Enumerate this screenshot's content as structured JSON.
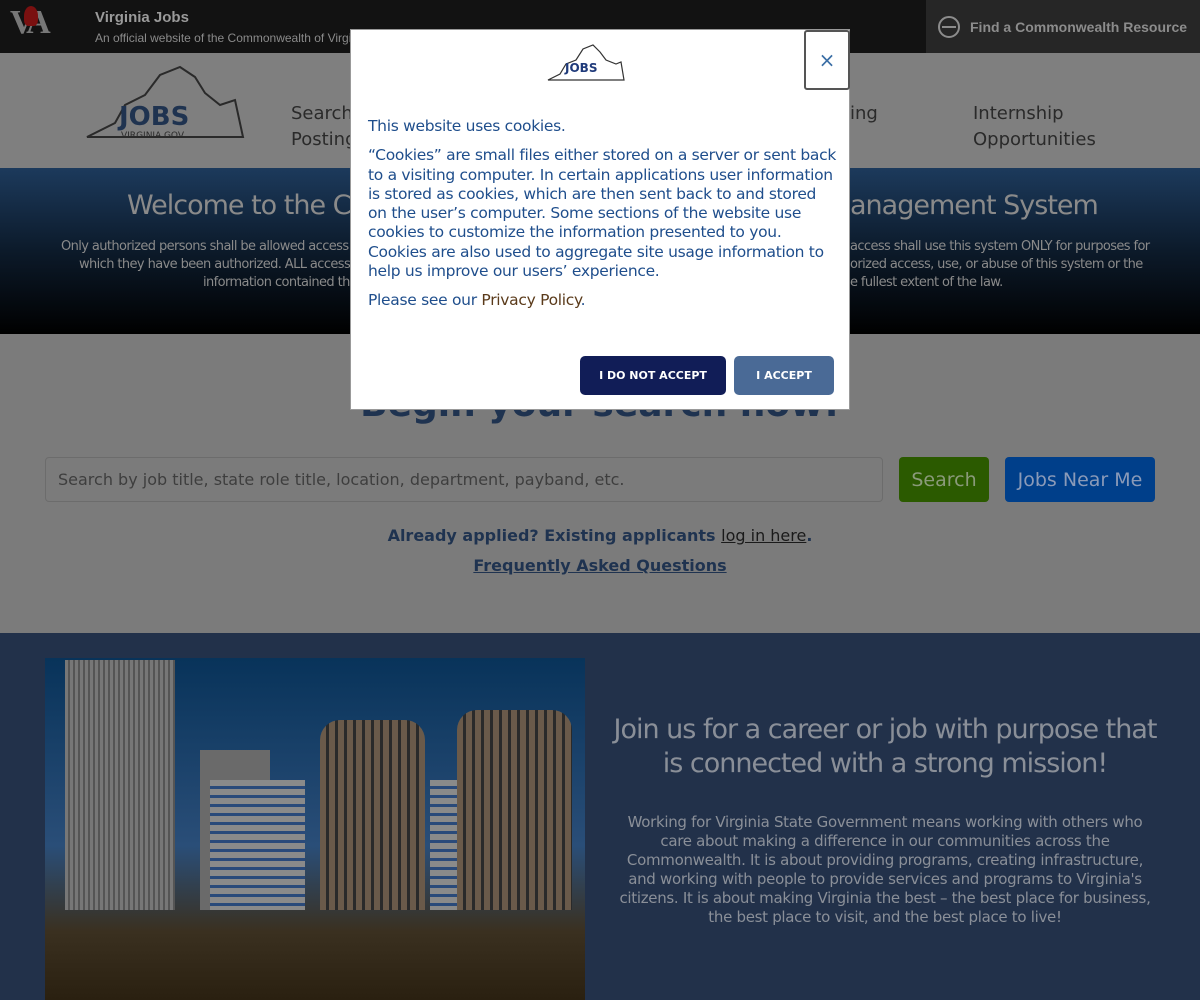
{
  "topbar": {
    "logo_text": "VA",
    "title": "Virginia Jobs",
    "subtitle": "An official website of the Commonwealth of Virgi",
    "resource_link": "Find a Commonwealth Resource"
  },
  "nav": {
    "logo_text": "JOBS",
    "logo_sub": "VIRGINIA.GOV",
    "items": [
      {
        "line1": "Search",
        "line2": "Posting"
      },
      {
        "line1": "ing",
        "line2": ""
      },
      {
        "line1": "Internship",
        "line2": "Opportunities"
      }
    ]
  },
  "banner": {
    "welcome_left": "Welcome to the Co",
    "welcome_right": "anagement System",
    "auth_left": [
      "Only authorized persons shall be allowed access to",
      "which they have been authorized. ALL access ar",
      "information contained the"
    ],
    "auth_right": [
      "access shall use this system ONLY for purposes for",
      "orized access, use, or abuse of this system or the",
      "e fullest extent of the law."
    ]
  },
  "search": {
    "heading": "Begin your search now!",
    "placeholder": "Search by job title, state role title, location, department, payband, etc.",
    "search_button": "Search",
    "near_button": "Jobs Near Me",
    "already_text": "Already applied?  Existing applicants ",
    "login_link": "log in here",
    "period": ".",
    "faq_link": "Frequently Asked Questions"
  },
  "mission": {
    "heading": "Join us for a career or job with purpose that is connected with a strong mission!",
    "body": "Working for Virginia State Government means working with others who care about making a difference in our communities across the Commonwealth. It is about providing programs, creating infrastructure, and working with people to provide services and programs to Virginia's citizens. It is about making Virginia the best – the best place for business, the best place to visit, and the best place to live!"
  },
  "modal": {
    "logo_text": "JOBS",
    "close": "×",
    "intro": "This website uses cookies.",
    "body": "“Cookies” are small files either stored on a server or sent back to a visiting computer. In certain applications user information is stored as cookies, which are then sent back to and stored on the user’s computer. Some sections of the website use cookies to customize the information presented to you. Cookies are also used to aggregate site usage information to help us improve our users’ experience.",
    "privacy_prefix": "Please see our ",
    "privacy_link": "Privacy Policy",
    "privacy_suffix": ".",
    "decline": "I DO NOT ACCEPT",
    "accept": "I ACCEPT"
  },
  "colors": {
    "modal_text": "#1f4e8c",
    "decline_bg": "#111d57",
    "accept_bg": "#4a6a96",
    "search_green": "#2b5a00",
    "near_blue": "#003f8a"
  }
}
